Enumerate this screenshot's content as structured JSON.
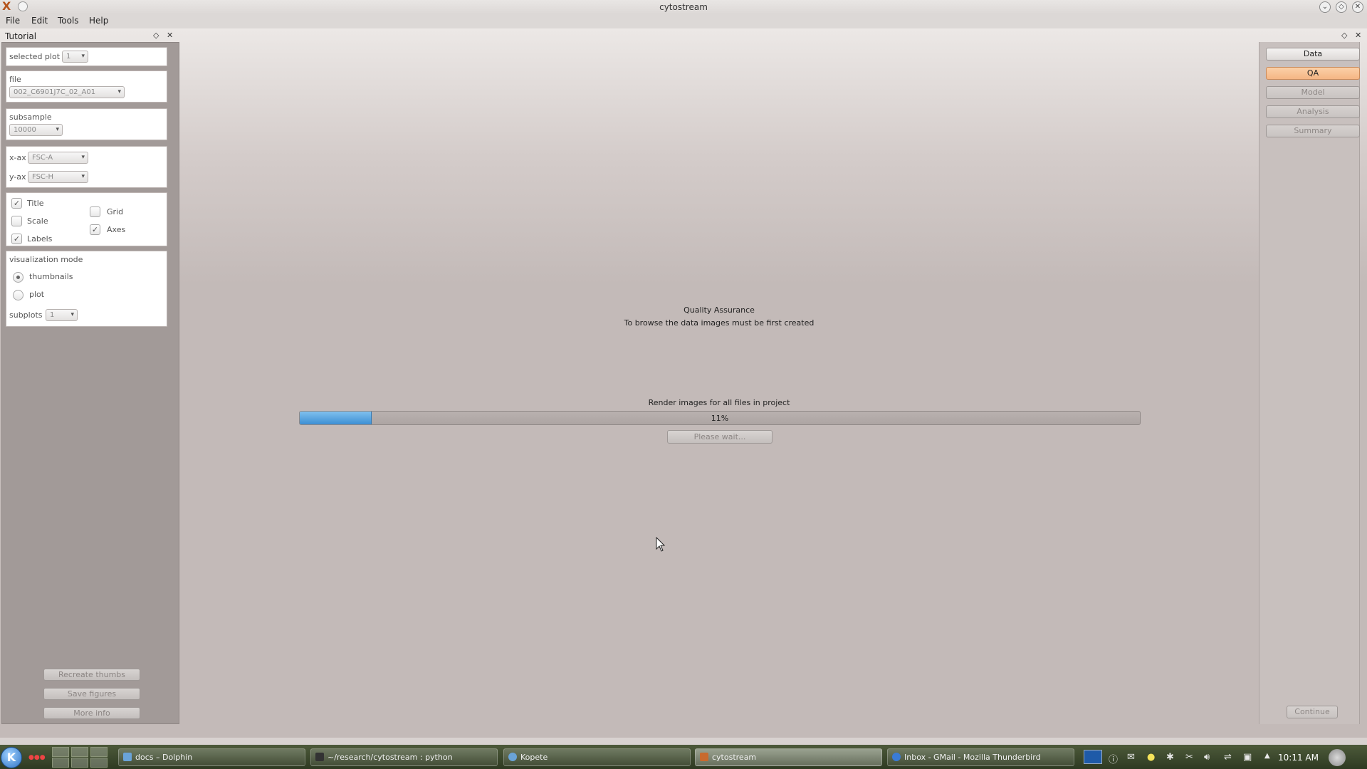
{
  "window": {
    "title": "cytostream",
    "app_icon": "X"
  },
  "menu": {
    "file": "File",
    "edit": "Edit",
    "tools": "Tools",
    "help": "Help"
  },
  "left_dock": {
    "title": "Tutorial",
    "selected_plot_label": "selected plot",
    "selected_plot_value": "1",
    "file_label": "file",
    "file_value": "002_C6901J7C_02_A01",
    "subsample_label": "subsample",
    "subsample_value": "10000",
    "xax_label": "x-ax",
    "xax_value": "FSC-A",
    "yax_label": "y-ax",
    "yax_value": "FSC-H",
    "options": {
      "title_label": "Title",
      "title_checked": true,
      "scale_label": "Scale",
      "scale_checked": false,
      "labels_label": "Labels",
      "labels_checked": true,
      "grid_label": "Grid",
      "grid_checked": false,
      "axes_label": "Axes",
      "axes_checked": true
    },
    "vis_mode_label": "visualization mode",
    "vis_thumbnails": "thumbnails",
    "vis_plot": "plot",
    "vis_selected": "thumbnails",
    "subplots_label": "subplots",
    "subplots_value": "1",
    "recreate_thumbs": "Recreate thumbs",
    "save_figures": "Save figures",
    "more_info": "More info"
  },
  "right_dock": {
    "nav": [
      {
        "label": "Data",
        "state": "normal"
      },
      {
        "label": "QA",
        "state": "active"
      },
      {
        "label": "Model",
        "state": "disabled"
      },
      {
        "label": "Analysis",
        "state": "disabled"
      },
      {
        "label": "Summary",
        "state": "disabled"
      }
    ],
    "continue": "Continue"
  },
  "center": {
    "heading": "Quality Assurance",
    "subheading": "To browse the data images must be first created",
    "progress_caption": "Render images for all files in project",
    "progress_percent": 11,
    "progress_text": "11%",
    "wait_button": "Please wait..."
  },
  "taskbar": {
    "tasks": [
      {
        "label": "docs – Dolphin",
        "active": false
      },
      {
        "label": "~/research/cytostream : python",
        "active": false
      },
      {
        "label": "Kopete",
        "active": false
      },
      {
        "label": "cytostream",
        "active": true
      },
      {
        "label": "Inbox - GMail - Mozilla Thunderbird",
        "active": false
      }
    ],
    "clock": "10:11 AM"
  },
  "colors": {
    "accent_active": "#f5b684",
    "progress_fill": "#3c8fd4",
    "background": "#c3bab8"
  }
}
